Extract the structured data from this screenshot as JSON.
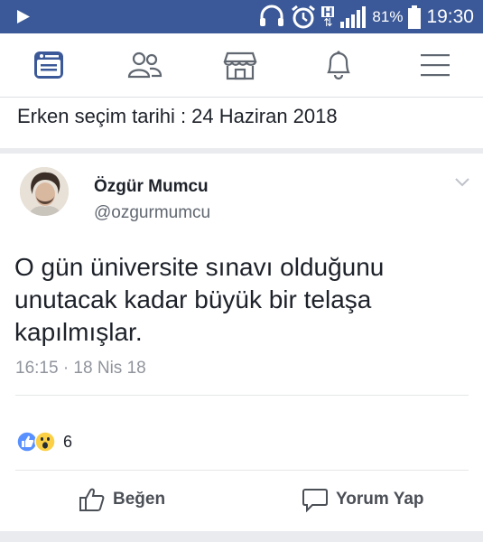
{
  "status_bar": {
    "battery_percent": "81%",
    "time": "19:30",
    "network_label": "H",
    "background": "#3b5998"
  },
  "nav": {
    "items": [
      {
        "icon": "news-feed-icon",
        "active": true
      },
      {
        "icon": "friends-icon"
      },
      {
        "icon": "marketplace-icon"
      },
      {
        "icon": "notifications-icon"
      },
      {
        "icon": "menu-icon"
      }
    ],
    "accent": "#3b5998"
  },
  "post": {
    "shared_text": "Erken seçim tarihi : 24 Haziran 2018"
  },
  "tweet": {
    "author_name": "Özgür Mumcu",
    "author_handle": "@ozgurmumcu",
    "text_lines": [
      "O gün üniversite sınavı olduğunu",
      "unutacak kadar büyük bir telaşa",
      "kapılmışlar."
    ],
    "timestamp": "16:15 · 18 Nis 18"
  },
  "reactions": {
    "types": [
      "like-icon",
      "wow-icon"
    ],
    "count": "6"
  },
  "actions": {
    "like_label": "Beğen",
    "comment_label": "Yorum Yap"
  }
}
